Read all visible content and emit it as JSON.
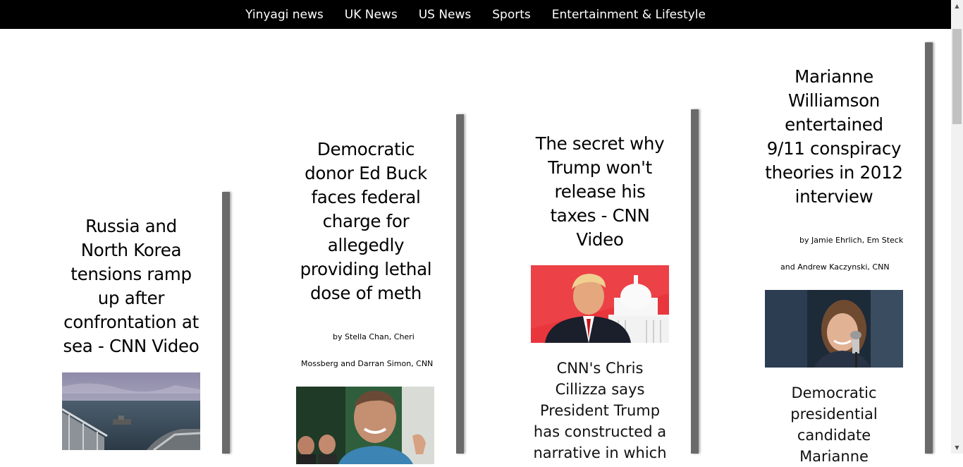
{
  "nav": {
    "items": [
      "Yinyagi news",
      "UK News",
      "US News",
      "Sports",
      "Entertainment & Lifestyle"
    ]
  },
  "cards": [
    {
      "headline": "Russia and North Korea tensions ramp up after confrontation at sea - CNN Video",
      "image": "ship-deck-at-sea-image"
    },
    {
      "headline": "Democratic donor Ed Buck faces federal charge for allegedly providing lethal dose of meth",
      "byline_1": "by Stella Chan, Cheri",
      "byline_2": "Mossberg and Darran Simon, CNN",
      "image": "ed-buck-photo"
    },
    {
      "headline": "The secret why Trump won't release his taxes - CNN Video",
      "image": "trump-capitol-image",
      "summary": "CNN's Chris Cillizza says President Trump has constructed a narrative in which"
    },
    {
      "headline": "Marianne Williamson entertained 9/11 conspiracy theories in 2012 interview",
      "byline_1": "by Jamie Ehrlich, Em Steck",
      "byline_2": "and Andrew Kaczynski, CNN",
      "image": "marianne-williamson-photo",
      "summary": "Democratic presidential candidate Marianne"
    }
  ],
  "colors": {
    "nav_background": "#000000",
    "divider": "#6a6a6a",
    "trump_background": "#e8363c"
  }
}
